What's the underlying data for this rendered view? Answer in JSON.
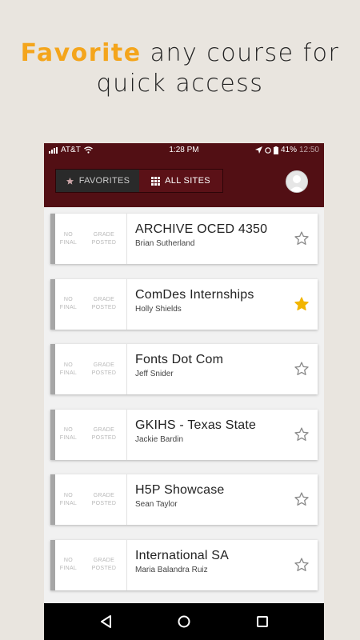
{
  "promo": {
    "accent_word": "Favorite",
    "line1_rest": " any course for",
    "line2": "quick access"
  },
  "status_bar": {
    "carrier": "AT&T",
    "time": "1:28 PM",
    "battery": "41%",
    "extra": "12:50"
  },
  "app_bar": {
    "favorites_label": "FAVORITES",
    "all_sites_label": "ALL SITES",
    "active_tab": "all_sites"
  },
  "courses": [
    {
      "grade": "NO FINAL GRADE POSTED",
      "title": "ARCHIVE OCED 4350",
      "instructor": "Brian Sutherland",
      "favorite": false
    },
    {
      "grade": "NO FINAL GRADE POSTED",
      "title": "ComDes Internships",
      "instructor": "Holly Shields",
      "favorite": true
    },
    {
      "grade": "NO FINAL GRADE POSTED",
      "title": "Fonts Dot Com",
      "instructor": "Jeff Snider",
      "favorite": false
    },
    {
      "grade": "NO FINAL GRADE POSTED",
      "title": "GKIHS - Texas State",
      "instructor": "Jackie Bardin",
      "favorite": false
    },
    {
      "grade": "NO FINAL GRADE POSTED",
      "title": "H5P Showcase",
      "instructor": "Sean Taylor",
      "favorite": false
    },
    {
      "grade": "NO FINAL GRADE POSTED",
      "title": "International SA",
      "instructor": "Maria Balandra Ruiz",
      "favorite": false
    }
  ],
  "colors": {
    "brand_maroon": "#520f14",
    "accent_gold": "#f4a51c",
    "star_filled": "#f2b500"
  },
  "icons": {
    "nav_back": "back-triangle-icon",
    "nav_home": "home-circle-icon",
    "nav_recents": "recents-square-icon"
  }
}
